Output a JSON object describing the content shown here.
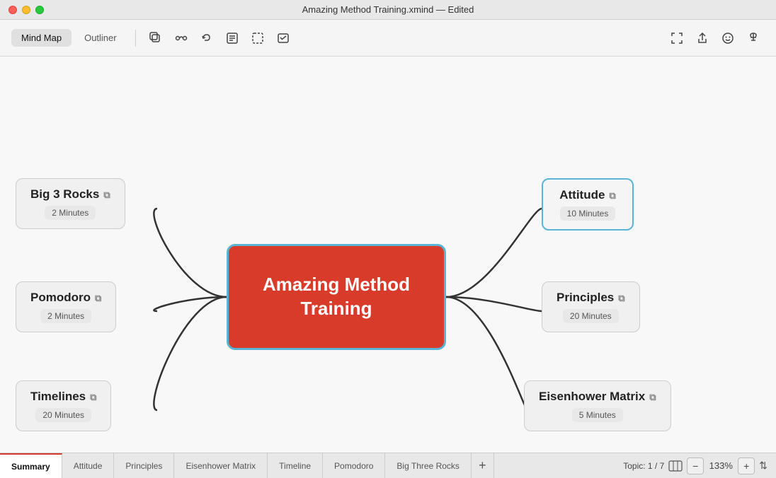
{
  "titleBar": {
    "title": "Amazing Method Training.xmind — Edited"
  },
  "toolbar": {
    "tabs": [
      {
        "id": "mindmap",
        "label": "Mind Map",
        "active": true
      },
      {
        "id": "outliner",
        "label": "Outliner",
        "active": false
      }
    ],
    "icons": [
      {
        "id": "duplicate",
        "symbol": "⧉",
        "tooltip": "Duplicate"
      },
      {
        "id": "relationship",
        "symbol": "↔",
        "tooltip": "Relationship"
      },
      {
        "id": "undo",
        "symbol": "↩",
        "tooltip": "Undo"
      },
      {
        "id": "summary",
        "symbol": "⊡",
        "tooltip": "Summary"
      },
      {
        "id": "boundary",
        "symbol": "⬚",
        "tooltip": "Boundary"
      },
      {
        "id": "task",
        "symbol": "✎",
        "tooltip": "Task"
      }
    ],
    "rightIcons": [
      {
        "id": "fullscreen",
        "symbol": "⛶",
        "tooltip": "Fullscreen"
      },
      {
        "id": "share",
        "symbol": "⬆",
        "tooltip": "Share"
      },
      {
        "id": "emoji",
        "symbol": "☺",
        "tooltip": "Emoji"
      },
      {
        "id": "pin",
        "symbol": "📌",
        "tooltip": "Pin"
      }
    ]
  },
  "mindmap": {
    "centerNode": {
      "title": "Amazing Method\nTraining"
    },
    "leftNodes": [
      {
        "id": "big3rocks",
        "title": "Big 3 Rocks",
        "time": "2 Minutes"
      },
      {
        "id": "pomodoro",
        "title": "Pomodoro",
        "time": "2 Minutes"
      },
      {
        "id": "timelines",
        "title": "Timelines",
        "time": "20 Minutes"
      }
    ],
    "rightNodes": [
      {
        "id": "attitude",
        "title": "Attitude",
        "time": "10 Minutes",
        "selected": true
      },
      {
        "id": "principles",
        "title": "Principles",
        "time": "20 Minutes"
      },
      {
        "id": "eisenhower",
        "title": "Eisenhower Matrix",
        "time": "5 Minutes"
      }
    ]
  },
  "bottomTabs": {
    "tabs": [
      {
        "id": "summary",
        "label": "Summary",
        "active": true
      },
      {
        "id": "attitude",
        "label": "Attitude",
        "active": false
      },
      {
        "id": "principles",
        "label": "Principles",
        "active": false
      },
      {
        "id": "eisenhower",
        "label": "Eisenhower Matrix",
        "active": false
      },
      {
        "id": "timeline",
        "label": "Timeline",
        "active": false
      },
      {
        "id": "pomodoro",
        "label": "Pomodoro",
        "active": false
      },
      {
        "id": "bigthreerocks",
        "label": "Big Three Rocks",
        "active": false
      }
    ],
    "addLabel": "+",
    "topicInfo": "Topic: 1 / 7",
    "zoomMinus": "−",
    "zoomPlus": "+",
    "zoomValue": "133%"
  }
}
